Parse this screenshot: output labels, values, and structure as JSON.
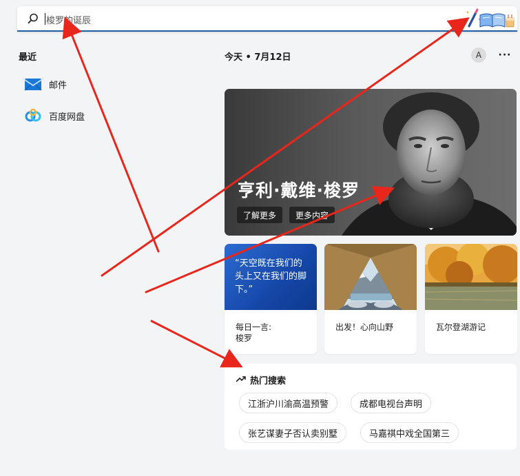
{
  "search": {
    "value": "梭罗的诞辰",
    "icon": "search-icon"
  },
  "recent": {
    "title": "最近",
    "apps": [
      {
        "label": "邮件",
        "icon": "mail-icon"
      },
      {
        "label": "百度网盘",
        "icon": "baidu-netdisk-icon"
      }
    ]
  },
  "header": {
    "today": "今天 • 7月12日",
    "avatar_letter": "A",
    "more": "···"
  },
  "hero": {
    "title": "亨利·戴维·梭罗",
    "learn_more": "了解更多",
    "more_content": "更多内容"
  },
  "cards": [
    {
      "quote": "“天空既在我们的头上又在我们的脚下。”",
      "label": "每日一言:\n梭罗"
    },
    {
      "label": "出发！心向山野"
    },
    {
      "label": "瓦尔登湖游记"
    }
  ],
  "trending": {
    "title": "热门搜索",
    "items": [
      "江浙沪川渝高温预警",
      "成都电视台声明",
      "张艺谋妻子否认卖别墅",
      "马嘉祺中戏全国第三"
    ]
  },
  "colors": {
    "accent": "#1f5fa8",
    "annotation_arrow": "#e8261c"
  }
}
